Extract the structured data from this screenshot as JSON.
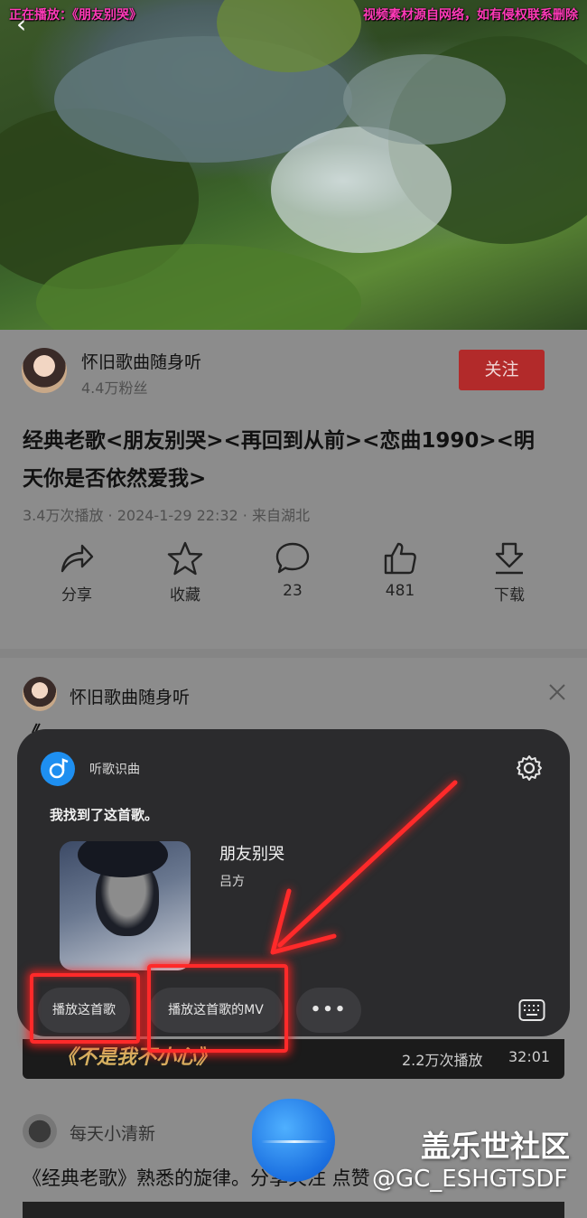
{
  "video": {
    "now_playing": "正在播放：《朋友别哭》",
    "copyright_notice": "视频素材源自网络，如有侵权联系删除"
  },
  "author": {
    "name": "怀旧歌曲随身听",
    "followers": "4.4万粉丝",
    "follow_label": "关注"
  },
  "post": {
    "title_line1": "经典老歌<朋友别哭><再回到从前><恋曲1990><明",
    "title_line2": "天你是否依然爱我>",
    "meta": "3.4万次播放 · 2024-1-29 22:32 · 来自湖北"
  },
  "actions": [
    {
      "label": "分享",
      "icon": "share-icon"
    },
    {
      "label": "收藏",
      "icon": "star-icon"
    },
    {
      "label": "23",
      "icon": "comment-icon"
    },
    {
      "label": "481",
      "icon": "thumbs-up-icon"
    },
    {
      "label": "下载",
      "icon": "download-icon"
    }
  ],
  "feed_item": {
    "author": "怀旧歌曲随身听",
    "close_icon": "close-icon",
    "overlay_title": "《不是我不小心》",
    "plays": "2.2万次播放",
    "duration": "32:01"
  },
  "feed_item2": {
    "author": "每天小清新",
    "text": "《经典老歌》熟悉的旋律。分享关注 点赞"
  },
  "popup": {
    "app_name": "听歌识曲",
    "found_text": "我找到了这首歌。",
    "song_title": "朋友别哭",
    "artist": "吕方",
    "play_song_label": "播放这首歌",
    "play_mv_label": "播放这首歌的MV",
    "more_label": "•••"
  },
  "watermark": {
    "line1": "盖乐世社区",
    "line2": "@GC_ESHGTSDF"
  },
  "colors": {
    "follow": "#b22a2a",
    "highlight": "#ff2a2a",
    "popup_bg": "#2b2b2d",
    "app_icon": "#1e8ff0"
  }
}
